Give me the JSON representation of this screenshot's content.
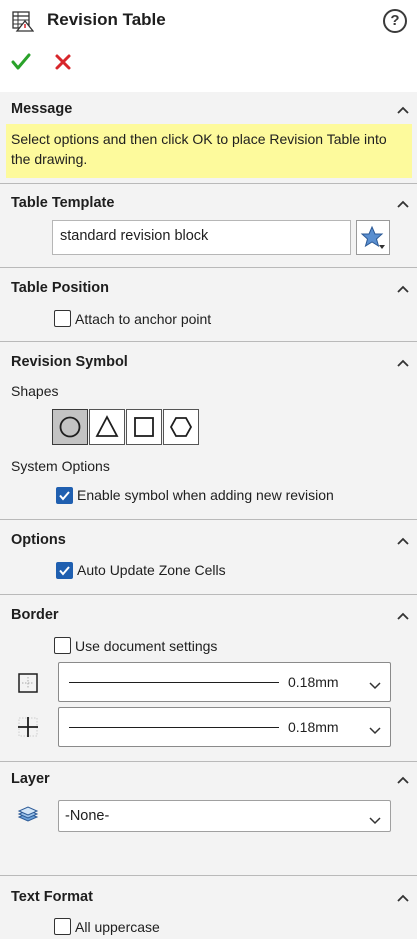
{
  "header": {
    "title": "Revision Table",
    "help_glyph": "?",
    "icons": {
      "table": "revision-table-icon",
      "help": "help-icon",
      "ok": "checkmark-icon",
      "cancel": "x-icon"
    },
    "colors": {
      "ok": "#2aa22a",
      "cancel": "#d8262b"
    }
  },
  "sections": {
    "message": {
      "title": "Message",
      "text": "Select options and then click OK to place Revision Table into the drawing.",
      "highlight_color": "#fdfa9c"
    },
    "table_template": {
      "title": "Table Template",
      "value": "standard revision block",
      "browse_icon": "favorite-star-icon"
    },
    "table_position": {
      "title": "Table Position",
      "attach_label": "Attach to anchor point",
      "attach_checked": false
    },
    "revision_symbol": {
      "title": "Revision Symbol",
      "shapes_label": "Shapes",
      "shapes": [
        "circle",
        "triangle",
        "square",
        "hexagon"
      ],
      "selected_shape": "circle",
      "system_options_label": "System Options",
      "enable_label": "Enable symbol when adding new revision",
      "enable_checked": true
    },
    "options": {
      "title": "Options",
      "auto_update_label": "Auto Update Zone Cells",
      "auto_update_checked": true
    },
    "border": {
      "title": "Border",
      "use_doc_label": "Use document settings",
      "use_doc_checked": false,
      "box_border_value": "0.18mm",
      "grid_border_value": "0.18mm"
    },
    "layer": {
      "title": "Layer",
      "value": "-None-"
    },
    "text_format": {
      "title": "Text Format",
      "uppercase_label": "All uppercase",
      "uppercase_checked": false
    }
  },
  "colors": {
    "accent": "#1f5fb0",
    "panel_bg": "#f3f3f3"
  }
}
